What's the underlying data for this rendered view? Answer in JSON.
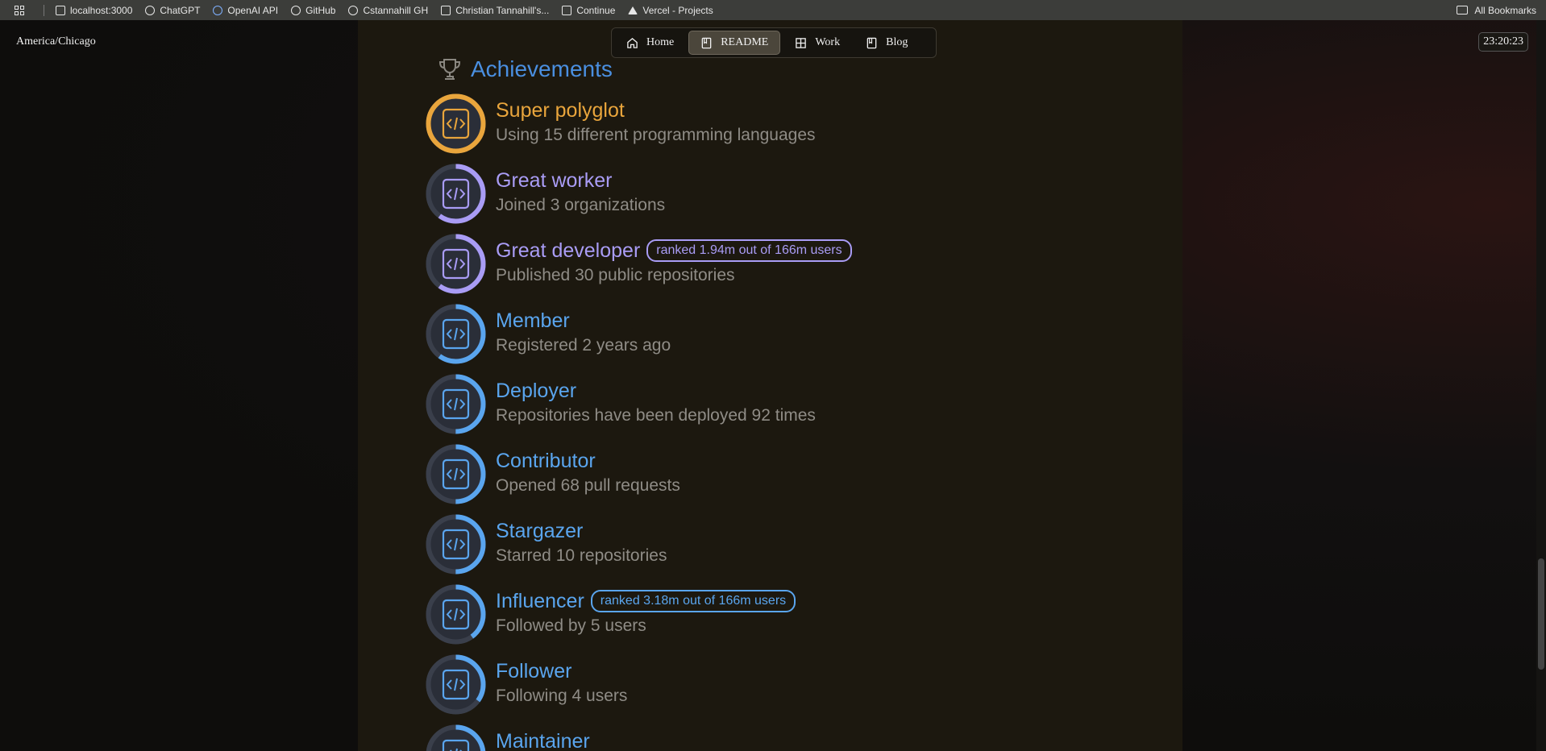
{
  "bookmarks": {
    "items": [
      {
        "label": "localhost:3000",
        "icon": "page-icon"
      },
      {
        "label": "ChatGPT",
        "icon": "chatgpt-icon"
      },
      {
        "label": "OpenAI API",
        "icon": "openai-icon"
      },
      {
        "label": "GitHub",
        "icon": "github-icon"
      },
      {
        "label": "Cstannahill GH",
        "icon": "github-icon"
      },
      {
        "label": "Christian Tannahill's...",
        "icon": "page-icon"
      },
      {
        "label": "Continue",
        "icon": "continue-icon"
      },
      {
        "label": "Vercel - Projects",
        "icon": "vercel-icon"
      }
    ],
    "all_label": "All Bookmarks"
  },
  "header": {
    "timezone": "America/Chicago",
    "clock": "23:20:23"
  },
  "nav": {
    "items": [
      {
        "label": "Home",
        "icon": "home-icon"
      },
      {
        "label": "README",
        "icon": "book-icon",
        "active": true
      },
      {
        "label": "Work",
        "icon": "grid-icon"
      },
      {
        "label": "Blog",
        "icon": "book-icon"
      }
    ]
  },
  "section": {
    "title": "Achievements"
  },
  "achievements": [
    {
      "title": "Super polyglot",
      "desc": "Using 15 different programming languages",
      "color": "#e9a53c",
      "rank": ""
    },
    {
      "title": "Great worker",
      "desc": "Joined 3 organizations",
      "color": "#a99cf5",
      "rank": ""
    },
    {
      "title": "Great developer",
      "desc": "Published 30 public repositories",
      "color": "#a99cf5",
      "rank": "ranked 1.94m out of 166m users"
    },
    {
      "title": "Member",
      "desc": "Registered 2 years ago",
      "color": "#5aa5ee",
      "rank": ""
    },
    {
      "title": "Deployer",
      "desc": "Repositories have been deployed 92 times",
      "color": "#5aa5ee",
      "rank": ""
    },
    {
      "title": "Contributor",
      "desc": "Opened 68 pull requests",
      "color": "#5aa5ee",
      "rank": ""
    },
    {
      "title": "Stargazer",
      "desc": "Starred 10 repositories",
      "color": "#5aa5ee",
      "rank": ""
    },
    {
      "title": "Influencer",
      "desc": "Followed by 5 users",
      "color": "#5aa5ee",
      "rank": "ranked 3.18m out of 166m users"
    },
    {
      "title": "Follower",
      "desc": "Following 4 users",
      "color": "#5aa5ee",
      "rank": ""
    },
    {
      "title": "Maintainer",
      "desc": "",
      "color": "#5aa5ee",
      "rank": ""
    }
  ]
}
